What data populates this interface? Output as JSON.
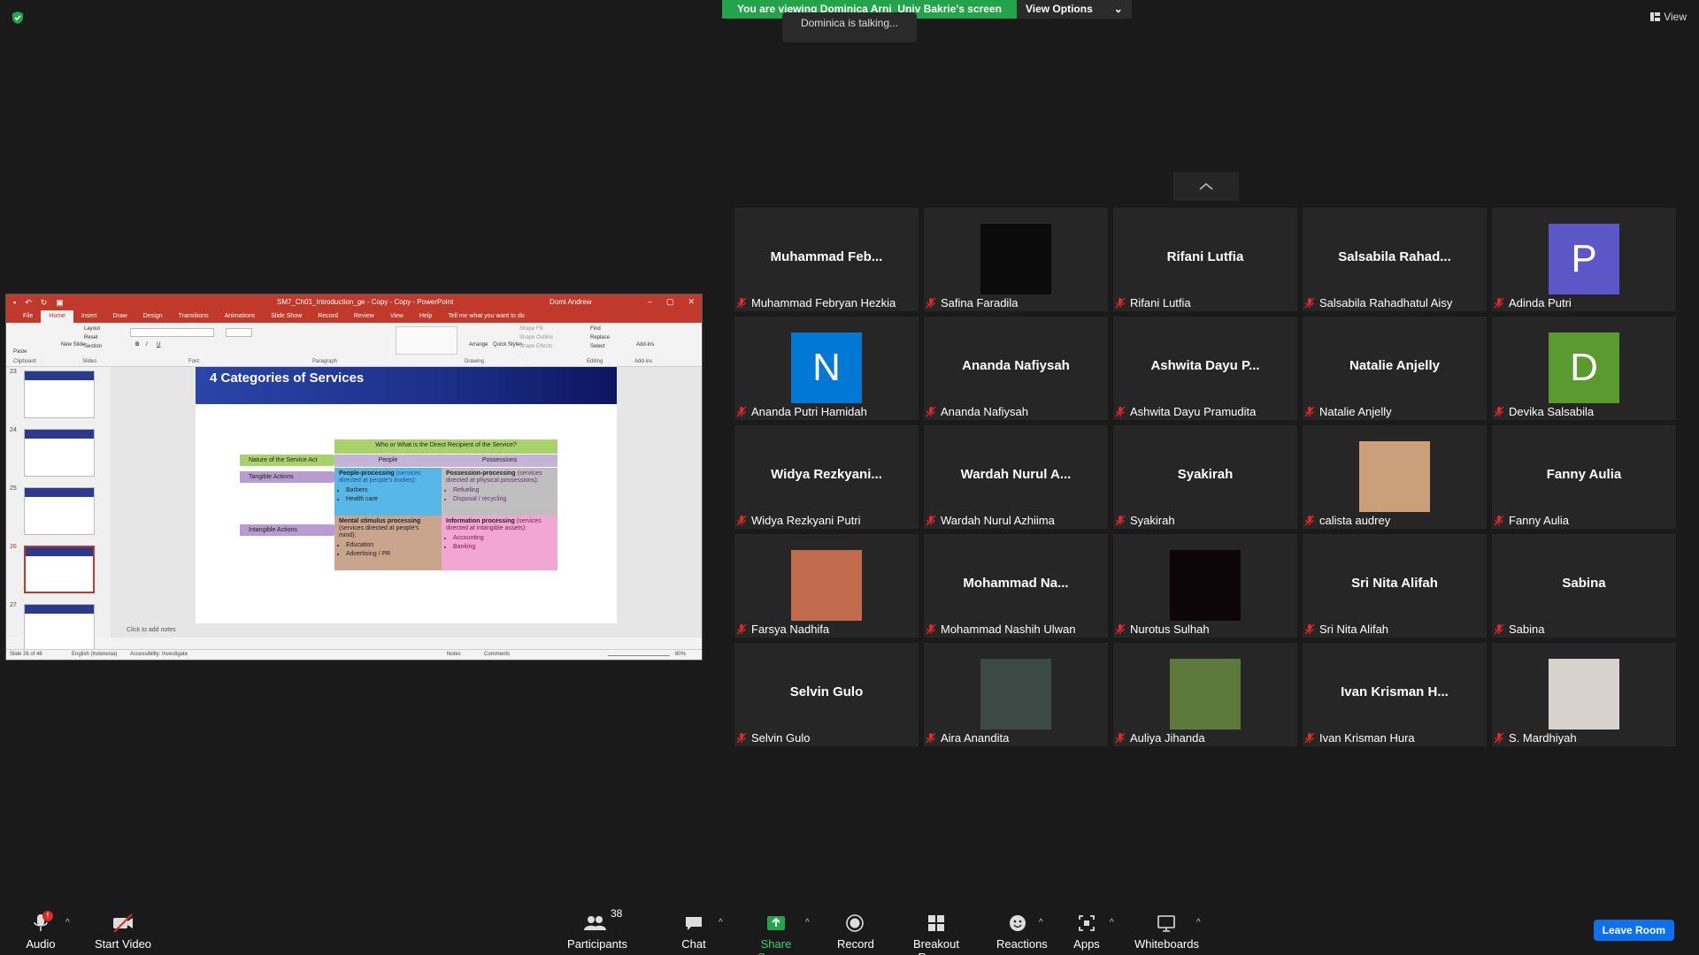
{
  "banner": {
    "viewing": "You are viewing Dominica Arni_Univ Bakrie's screen",
    "options": "View Options",
    "talking": "Dominica is talking...",
    "view": "View"
  },
  "ppt": {
    "title": "SM7_Ch01_Introduction_ge - Copy - Copy  -  PowerPoint",
    "user": "Domi Andrew",
    "tabs": [
      "File",
      "Home",
      "Insert",
      "Draw",
      "Design",
      "Transitions",
      "Animations",
      "Slide Show",
      "Record",
      "Review",
      "View",
      "Help",
      "Tell me what you want to do"
    ],
    "ribbon": {
      "clipboard": "Clipboard",
      "slides": "Slides",
      "font": "Font",
      "paragraph": "Paragraph",
      "drawing": "Drawing",
      "editing": "Editing",
      "addins": "Add-ins",
      "paste": "Paste",
      "new_slide": "New Slide",
      "layout": "Layout",
      "reset": "Reset",
      "section": "Section",
      "arrange": "Arrange",
      "quick_styles": "Quick Styles",
      "shape_fill": "Shape Fill",
      "shape_outline": "Shape Outline",
      "shape_effects": "Shape Effects",
      "find": "Find",
      "replace": "Replace",
      "select": "Select",
      "addins_btn": "Add-ins"
    },
    "thumb_numbers": [
      "23",
      "24",
      "25",
      "26",
      "27"
    ],
    "slide": {
      "title": "4 Categories of Services",
      "top_header": "Who or What is the Direct Recipient of the Service?",
      "nature": "Nature of the Service Act",
      "people": "People",
      "possessions": "Possessions",
      "tangible": "Tangible Actions",
      "intangible": "Intangible Actions",
      "c1_title": "People-processing",
      "c1_sub": "(services directed at people's bodies):",
      "c1_items": [
        "Barbers",
        "Health care"
      ],
      "c2_title": "Possession-processing",
      "c2_sub": "(services directed at physical possessions):",
      "c2_items": [
        "Refueling",
        "Disposal / recycling"
      ],
      "c3_title": "Mental stimulus processing",
      "c3_sub": "(services directed at people's mind):",
      "c3_items": [
        "Education",
        "Advertising / PR"
      ],
      "c4_title": "Information processing",
      "c4_sub": "(services directed at intangible assets):",
      "c4_items": [
        "Accounting",
        "Banking"
      ]
    },
    "notes": "Click to add notes",
    "status": {
      "slide": "Slide 26 of 46",
      "lang": "English (Indonesia)",
      "access": "Accessibility: Investigate",
      "notes": "Notes",
      "comments": "Comments",
      "zoom": "80%"
    }
  },
  "participants": [
    {
      "display": "Muhammad  Feb...",
      "name": "Muhammad Febryan Hezkia",
      "type": "text"
    },
    {
      "display": "",
      "name": "Safina Faradila",
      "type": "photo",
      "color": "#0b0b0b"
    },
    {
      "display": "Rifani Lutfia",
      "name": "Rifani Lutfia",
      "type": "text"
    },
    {
      "display": "Salsabila  Rahad...",
      "name": "Salsabila Rahadhatul Aisy",
      "type": "text"
    },
    {
      "display": "P",
      "name": "Adinda Putri",
      "type": "avatar",
      "color": "#5b57c7"
    },
    {
      "display": "N",
      "name": "Ananda Putri Hamidah",
      "type": "avatar",
      "color": "#0078d4"
    },
    {
      "display": "Ananda Nafiysah",
      "name": "Ananda Nafiysah",
      "type": "text"
    },
    {
      "display": "Ashwita Dayu P...",
      "name": "Ashwita Dayu Pramudita",
      "type": "text"
    },
    {
      "display": "Natalie Anjelly",
      "name": "Natalie Anjelly",
      "type": "text"
    },
    {
      "display": "D",
      "name": "Devika Salsabila",
      "type": "avatar",
      "color": "#5b9a2f"
    },
    {
      "display": "Widya  Rezkyani...",
      "name": "Widya Rezkyani Putri",
      "type": "text"
    },
    {
      "display": "Wardah  Nurul  A...",
      "name": "Wardah Nurul Azhiima",
      "type": "text"
    },
    {
      "display": "Syakirah",
      "name": "Syakirah",
      "type": "text"
    },
    {
      "display": "",
      "name": "calista audrey",
      "type": "photo",
      "color": "#c9a07a"
    },
    {
      "display": "Fanny Aulia",
      "name": "Fanny Aulia",
      "type": "text"
    },
    {
      "display": "",
      "name": "Farsya Nadhifa",
      "type": "photo",
      "color": "#c26a4e"
    },
    {
      "display": "Mohammad  Na...",
      "name": "Mohammad Nashih Ulwan",
      "type": "text"
    },
    {
      "display": "",
      "name": "Nurotus Sulhah",
      "type": "photo",
      "color": "#0e0509"
    },
    {
      "display": "Sri Nita Alifah",
      "name": "Sri Nita Alifah",
      "type": "text"
    },
    {
      "display": "Sabina",
      "name": "Sabina",
      "type": "text"
    },
    {
      "display": "Selvin Gulo",
      "name": "Selvin Gulo",
      "type": "text"
    },
    {
      "display": "",
      "name": "Aira Anandita",
      "type": "photo",
      "color": "#3b4a44"
    },
    {
      "display": "",
      "name": "Auliya Jihanda",
      "type": "photo",
      "color": "#5d7a3c"
    },
    {
      "display": "Ivan  Krisman  H...",
      "name": "Ivan Krisman Hura",
      "type": "text"
    },
    {
      "display": "",
      "name": "S. Mardhiyah",
      "type": "photo",
      "color": "#d8d2cf"
    }
  ],
  "toolbar": {
    "audio": "Audio",
    "audio_badge": "!",
    "video": "Start Video",
    "participants": "Participants",
    "participants_count": "38",
    "chat": "Chat",
    "share": "Share Screen",
    "record": "Record",
    "breakout": "Breakout Rooms",
    "reactions": "Reactions",
    "apps": "Apps",
    "whiteboards": "Whiteboards",
    "leave": "Leave Room"
  },
  "colors": {
    "share_green": "#23a44a",
    "leave_blue": "#0e71eb",
    "ppt_red": "#c0392b"
  }
}
